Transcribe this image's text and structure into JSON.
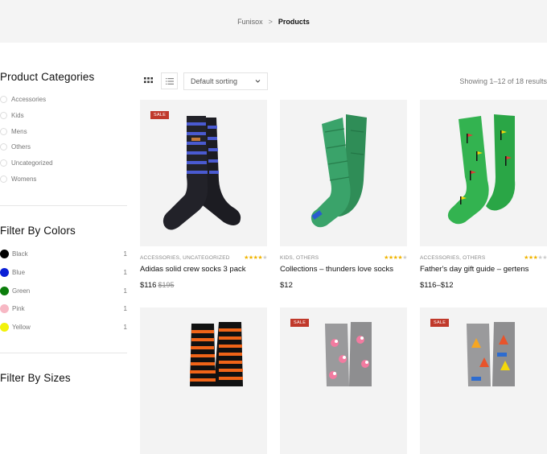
{
  "breadcrumb": {
    "home": "Funisox",
    "separator": ">",
    "current": "Products"
  },
  "sidebar": {
    "categories_title": "Product Categories",
    "categories": [
      "Accessories",
      "Kids",
      "Mens",
      "Others",
      "Uncategorized",
      "Womens"
    ],
    "colors_title": "Filter By Colors",
    "colors": [
      {
        "label": "Black",
        "count": "1",
        "hex": "#000000"
      },
      {
        "label": "Blue",
        "count": "1",
        "hex": "#0a1fd6"
      },
      {
        "label": "Green",
        "count": "1",
        "hex": "#0b7d0b"
      },
      {
        "label": "Pink",
        "count": "1",
        "hex": "#f7b8c4"
      },
      {
        "label": "Yellow",
        "count": "1",
        "hex": "#f2f20a"
      }
    ],
    "sizes_title": "Filter By Sizes"
  },
  "toolbar": {
    "grid_icon": "grid-icon",
    "list_icon": "list-icon",
    "sort_label": "Default sorting",
    "showing": "Showing 1–12 of 18 results"
  },
  "products": [
    {
      "sale": "SALE",
      "cats": "ACCESSORIES, UNCATEGORIZED",
      "title": "Adidas solid crew socks 3 pack",
      "price": "$116",
      "old_price": "$195",
      "rating": 4.5
    },
    {
      "sale": "",
      "cats": "KIDS, OTHERS",
      "title": "Collections – thunders love socks",
      "price": "$12",
      "old_price": "",
      "rating": 4
    },
    {
      "sale": "",
      "cats": "ACCESSORIES, OTHERS",
      "title": "Father's day gift guide – gertens",
      "price": "$116–$12",
      "old_price": "",
      "rating": 3.5
    },
    {
      "sale": "",
      "cats": "",
      "title": "",
      "price": "",
      "old_price": "",
      "rating": 0
    },
    {
      "sale": "SALE",
      "cats": "",
      "title": "",
      "price": "",
      "old_price": "",
      "rating": 0
    },
    {
      "sale": "SALE",
      "cats": "",
      "title": "",
      "price": "",
      "old_price": "",
      "rating": 0
    }
  ]
}
